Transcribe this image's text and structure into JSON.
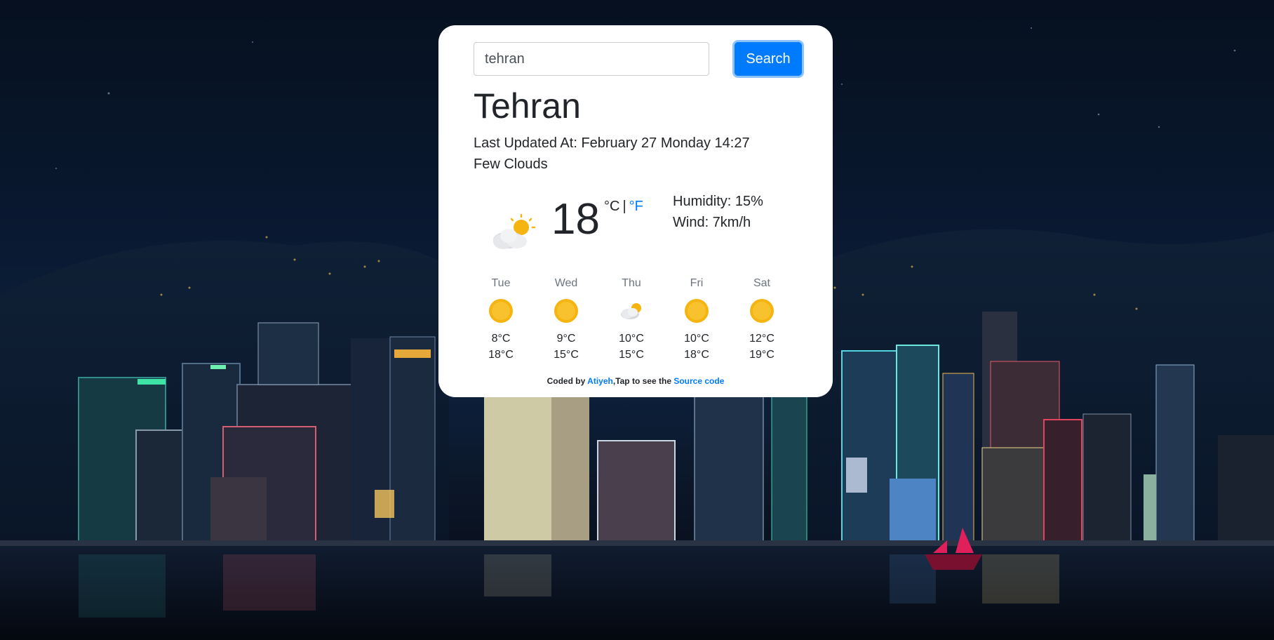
{
  "search": {
    "value": "tehran",
    "placeholder": "",
    "button_label": "Search"
  },
  "weather": {
    "city": "Tehran",
    "last_updated": "Last Updated At: February 27 Monday 14:27",
    "description": "Few Clouds",
    "icon": "few-clouds-icon",
    "temperature": "18",
    "unit_c": "°C",
    "unit_sep": "|",
    "unit_f": "°F",
    "humidity": "Humidity: 15%",
    "wind": "Wind: 7km/h"
  },
  "forecast": [
    {
      "day": "Tue",
      "icon": "sun-icon",
      "min": "8°C",
      "max": "18°C"
    },
    {
      "day": "Wed",
      "icon": "sun-icon",
      "min": "9°C",
      "max": "15°C"
    },
    {
      "day": "Thu",
      "icon": "few-clouds-icon",
      "min": "10°C",
      "max": "15°C"
    },
    {
      "day": "Fri",
      "icon": "sun-icon",
      "min": "10°C",
      "max": "18°C"
    },
    {
      "day": "Sat",
      "icon": "sun-icon",
      "min": "12°C",
      "max": "19°C"
    }
  ],
  "footer": {
    "prefix": "Coded by",
    "author": "Atiyeh",
    "middle": ",Tap to see the",
    "source": "Source code"
  },
  "colors": {
    "accent": "#007bff",
    "card_bg": "#ffffff",
    "sun": "#f5b40f",
    "background": "#0a1a33"
  }
}
